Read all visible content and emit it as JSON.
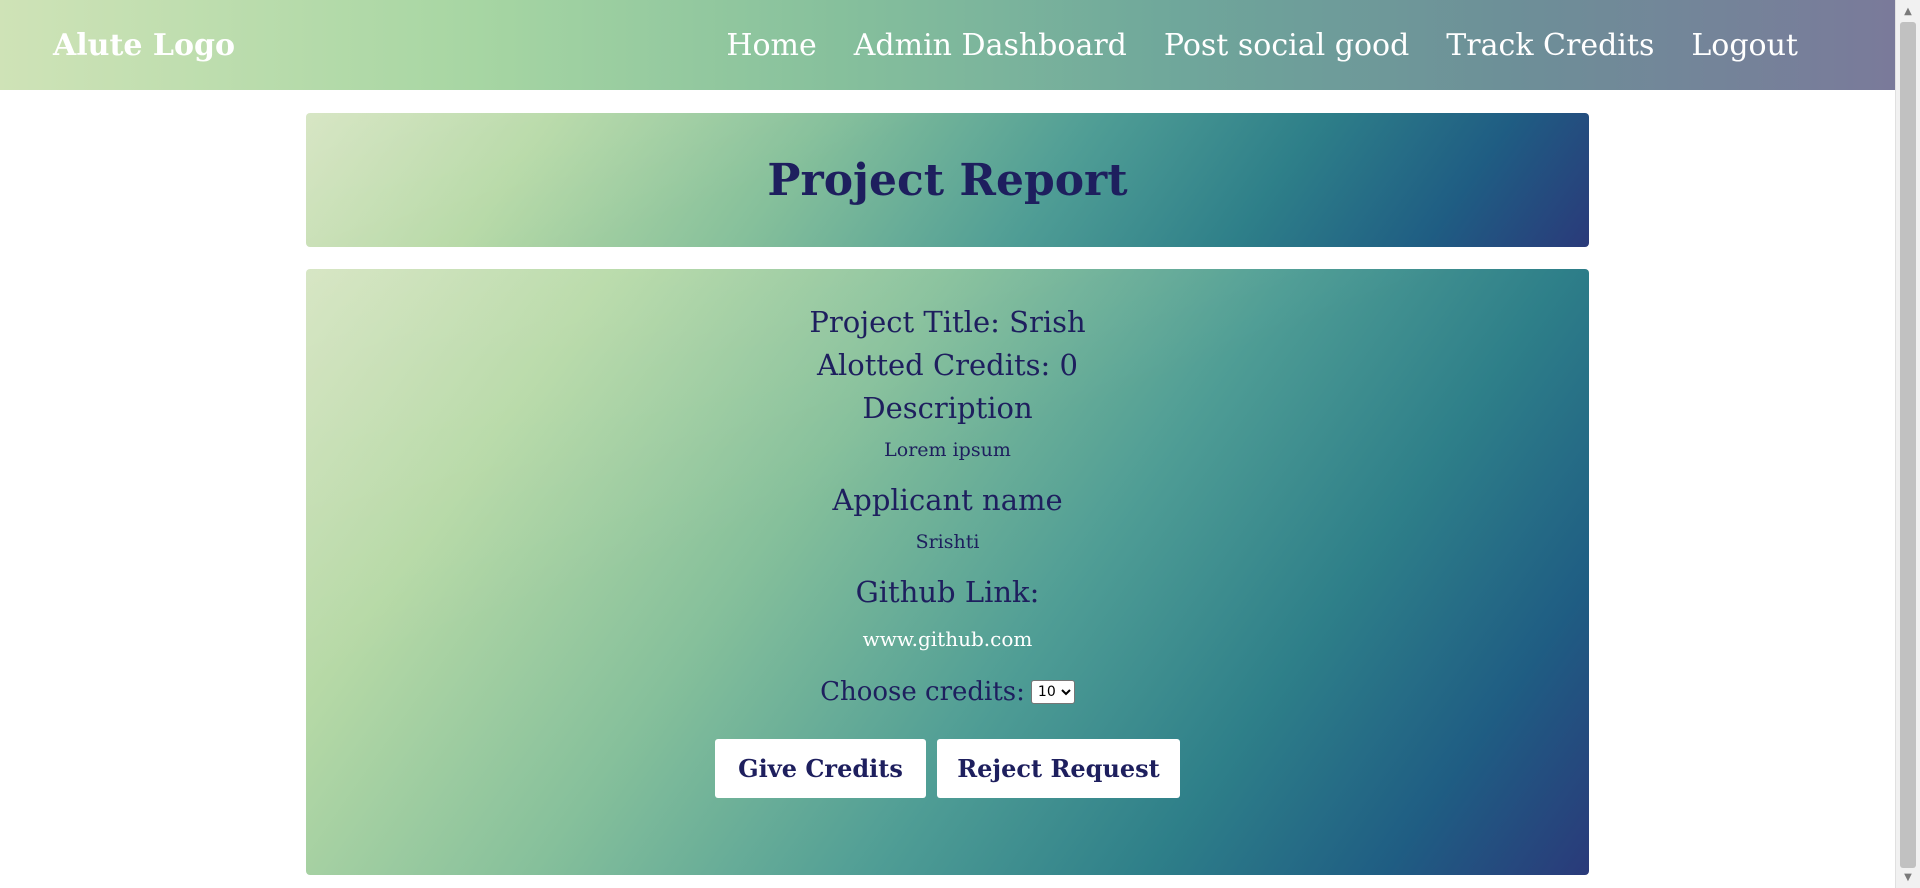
{
  "nav": {
    "brand": "Alute Logo",
    "links": [
      "Home",
      "Admin Dashboard",
      "Post social good",
      "Track Credits",
      "Logout"
    ]
  },
  "header": {
    "title": "Project Report"
  },
  "report": {
    "project_title": "Project Title: Srish",
    "allotted_credits": "Alotted Credits: 0",
    "description_label": "Description",
    "description_text": "Lorem ipsum",
    "applicant_label": "Applicant name",
    "applicant_name": "Srishti",
    "github_label": "Github Link:",
    "github_url": "www.github.com",
    "choose_credits_label": "Choose credits:",
    "credits_selected": "10",
    "give_button": "Give Credits",
    "reject_button": "Reject Request"
  },
  "colors": {
    "title_text": "#1e1f5e",
    "link_text": "#ffffff"
  }
}
